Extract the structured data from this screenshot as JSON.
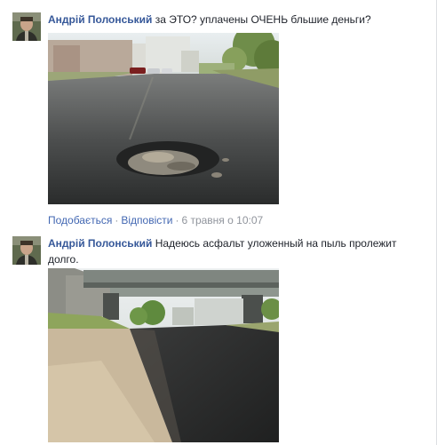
{
  "comments": [
    {
      "author": "Андрій Полонський",
      "text": "за ЭТО? уплачены ОЧЕНЬ бльшие деньги?",
      "photo_alt": "Фото",
      "actions": {
        "like": "Подобається",
        "separator": "·",
        "reply": "Відповісти",
        "timestamp": "6 травня о 10:07"
      }
    },
    {
      "author": "Андрій Полонський",
      "text": "Надеюсь асфальт уложенный на пыль пролежит долго.",
      "photo_alt": "Фото"
    }
  ],
  "colors": {
    "author_link": "#365899",
    "action_link": "#4267b2",
    "meta_text": "#90949c",
    "body_text": "#1d2129"
  },
  "icons": [
    "avatar-photo",
    "road-photo",
    "bridge-photo"
  ]
}
